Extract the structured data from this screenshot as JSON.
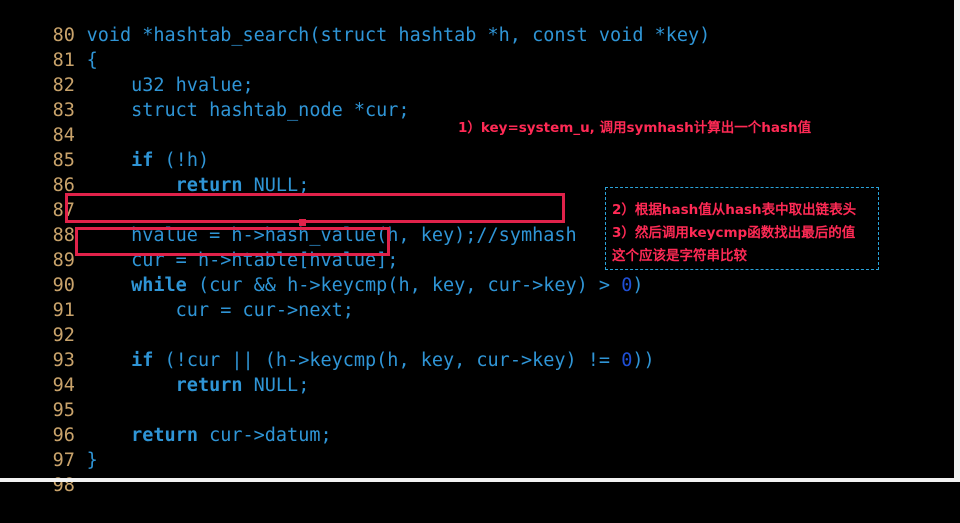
{
  "editor": {
    "lines": [
      {
        "num": "80",
        "code": "void *hashtab_search(struct hashtab *h, const void *key)"
      },
      {
        "num": "81",
        "code": "{"
      },
      {
        "num": "82",
        "code": "    u32 hvalue;"
      },
      {
        "num": "83",
        "code": "    struct hashtab_node *cur;"
      },
      {
        "num": "84",
        "code": ""
      },
      {
        "num": "85",
        "code_a": "    ",
        "code_kw": "if",
        "code_b": " (!h)"
      },
      {
        "num": "86",
        "code_a": "        ",
        "code_kw": "return",
        "code_b": " NULL;"
      },
      {
        "num": "87",
        "code": ""
      },
      {
        "num": "88",
        "code": "    hvalue = h->hash_value(h, key);//symhash"
      },
      {
        "num": "89",
        "code": "    cur = h->htable[hvalue];"
      },
      {
        "num": "90",
        "code_a": "    ",
        "code_kw": "while",
        "code_b": " (cur && h->keycmp(h, key, cur->key) > ",
        "code_zero": "0",
        "code_c": ")"
      },
      {
        "num": "91",
        "code": "        cur = cur->next;"
      },
      {
        "num": "92",
        "code": ""
      },
      {
        "num": "93",
        "code_a": "    ",
        "code_kw": "if",
        "code_b": " (!cur || (h->keycmp(h, key, cur->key) != ",
        "code_zero": "0",
        "code_c": "))"
      },
      {
        "num": "94",
        "code_a": "        ",
        "code_kw": "return",
        "code_b": " NULL;"
      },
      {
        "num": "95",
        "code": ""
      },
      {
        "num": "96",
        "code_a": "    ",
        "code_kw": "return",
        "code_b": " cur->datum;"
      },
      {
        "num": "97",
        "code": "}"
      },
      {
        "num": "98",
        "code": ""
      }
    ]
  },
  "annotations": {
    "note1": "1）key=system_u, 调用symhash计算出一个hash值",
    "note2": "2）根据hash值从hash表中取出链表头",
    "note3": "3）然后调用keycmp函数找出最后的值",
    "note4": "这个应该是字符串比较"
  },
  "colors": {
    "background": "#000000",
    "line_number": "#c9a36b",
    "code": "#2f95d6",
    "highlight": "#e0224a",
    "annotation_text": "#ff2a55",
    "annotation_border": "#2aa3d9"
  }
}
